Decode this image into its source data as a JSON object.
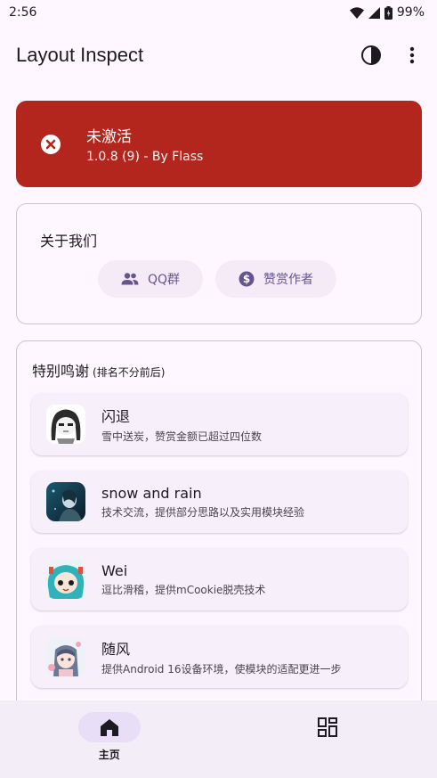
{
  "status_bar": {
    "time": "2:56",
    "battery": "99%",
    "icons": [
      "wifi-icon",
      "signal-icon",
      "battery-icon"
    ]
  },
  "app_bar": {
    "title": "Layout Inspect",
    "actions": [
      "theme-toggle-icon",
      "more-vert-icon"
    ]
  },
  "status_card": {
    "title": "未激活",
    "subtitle": "1.0.8 (9) - By Flass",
    "icon": "error-icon",
    "color": "#b3261e"
  },
  "about": {
    "title": "关于我们",
    "buttons": [
      {
        "label": "QQ群",
        "icon": "group-icon"
      },
      {
        "label": "赞赏作者",
        "icon": "dollar-icon"
      }
    ]
  },
  "thanks": {
    "title": "特别鸣谢",
    "note": "(排名不分前后)",
    "people": [
      {
        "name": "闪退",
        "desc": "雪中送炭，赞赏金额已超过四位数"
      },
      {
        "name": "snow and rain",
        "desc": "技术交流，提供部分思路以及实用模块经验"
      },
      {
        "name": "Wei",
        "desc": "逗比滑稽，提供mCookie脱壳技术"
      },
      {
        "name": "随风",
        "desc": "提供Android 16设备环境，使模块的适配更进一步"
      }
    ]
  },
  "bottom_nav": {
    "items": [
      {
        "label": "主页",
        "icon": "home-icon",
        "active": true
      },
      {
        "label": "",
        "icon": "dashboard-icon",
        "active": false
      }
    ]
  },
  "colors": {
    "accent": "#65558f",
    "error": "#b3261e",
    "background": "#fef7ff"
  }
}
